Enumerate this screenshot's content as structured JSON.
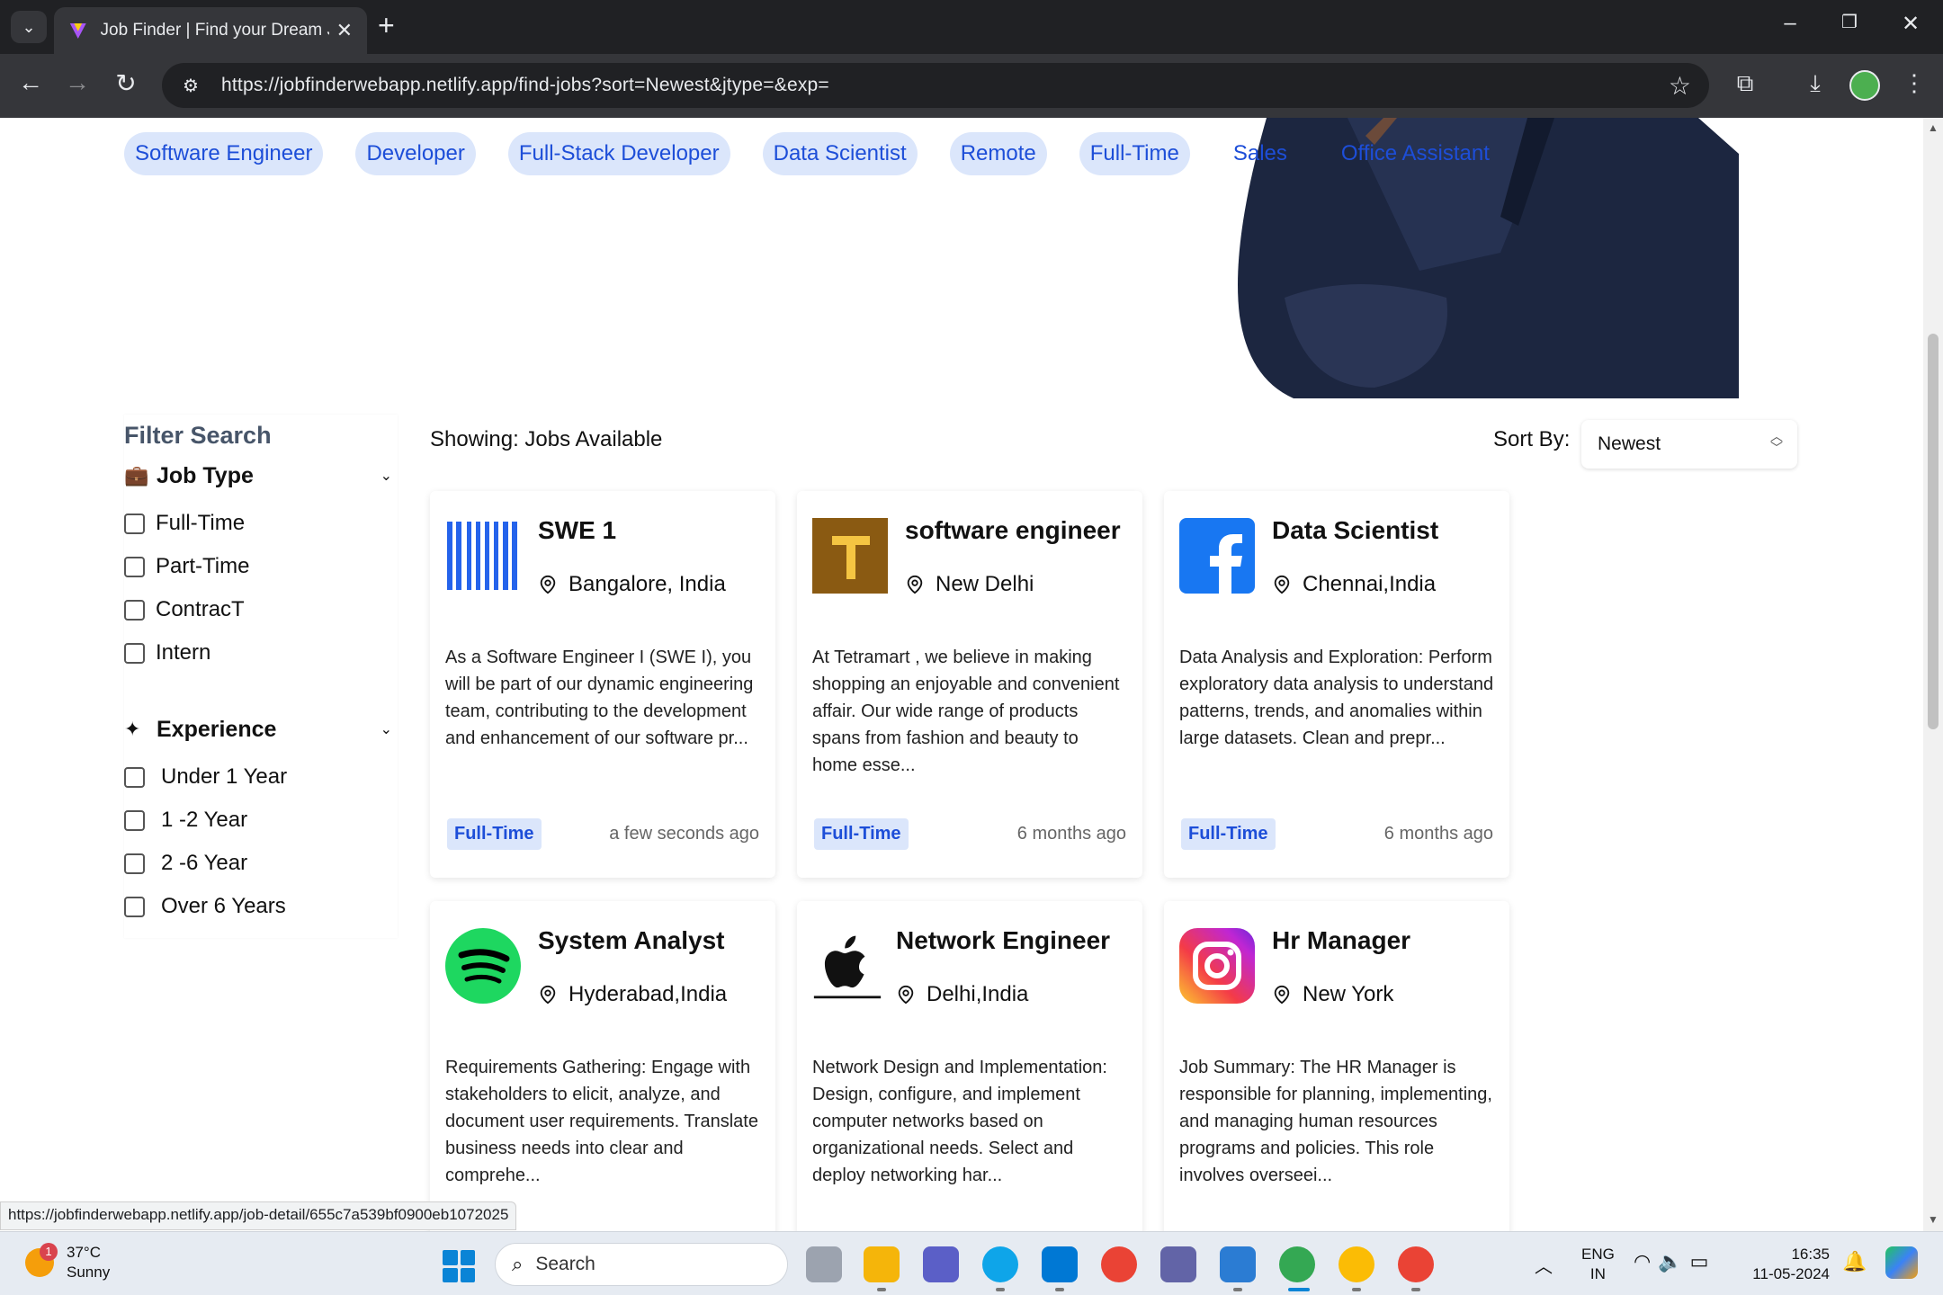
{
  "browser": {
    "tab_title": "Job Finder | Find your Dream Jo",
    "url": "https://jobfinderwebapp.netlify.app/find-jobs?sort=Newest&jtype=&exp=",
    "status_url": "https://jobfinderwebapp.netlify.app/job-detail/655c7a539bf0900eb1072025"
  },
  "chips": [
    "Software Engineer",
    "Developer",
    "Full-Stack Developer",
    "Data Scientist",
    "Remote",
    "Full-Time",
    "Sales",
    "Office Assistant"
  ],
  "filter": {
    "title": "Filter Search",
    "job_type": {
      "label": "Job Type",
      "options": [
        "Full-Time",
        "Part-Time",
        "ContracT",
        "Intern"
      ]
    },
    "experience": {
      "label": "Experience",
      "options": [
        "Under 1 Year",
        "1 -2 Year",
        "2 -6 Year",
        "Over 6 Years"
      ]
    }
  },
  "results": {
    "showing": "Showing: Jobs Available",
    "sort_label": "Sort By:",
    "sort_value": "Newest"
  },
  "jobs": [
    {
      "title": "SWE 1",
      "location": "Bangalore, India",
      "logo": "intuit-logo",
      "description": "As a Software Engineer I (SWE I), you will be part of our dynamic engineering team, contributing to the development and enhancement of our software pr...",
      "type": "Full-Time",
      "posted": "a few seconds ago"
    },
    {
      "title": "software engineer",
      "location": "New Delhi",
      "logo": "tetramart-logo",
      "description": "At Tetramart , we believe in making shopping an enjoyable and convenient affair. Our wide range of products spans from fashion and beauty to home esse...",
      "type": "Full-Time",
      "posted": "6 months ago"
    },
    {
      "title": "Data Scientist",
      "location": "Chennai,India",
      "logo": "facebook-logo",
      "description": "Data Analysis and Exploration: Perform exploratory data analysis to understand patterns, trends, and anomalies within large datasets. Clean and prepr...",
      "type": "Full-Time",
      "posted": "6 months ago"
    },
    {
      "title": "System Analyst",
      "location": "Hyderabad,India",
      "logo": "spotify-logo",
      "description": "Requirements Gathering: Engage with stakeholders to elicit, analyze, and document user requirements. Translate business needs into clear and comprehe...",
      "type": "",
      "posted": ""
    },
    {
      "title": "Network Engineer",
      "location": "Delhi,India",
      "logo": "apple-logo",
      "description": "Network Design and Implementation: Design, configure, and implement computer networks based on organizational needs. Select and deploy networking har...",
      "type": "",
      "posted": ""
    },
    {
      "title": "Hr Manager",
      "location": "New York",
      "logo": "instagram-logo",
      "description": "Job Summary: The HR Manager is responsible for planning, implementing, and managing human resources programs and policies. This role involves overseei...",
      "type": "",
      "posted": ""
    }
  ],
  "taskbar": {
    "weather_temp": "37°C",
    "weather_desc": "Sunny",
    "weather_badge": "1",
    "search_placeholder": "Search",
    "lang_top": "ENG",
    "lang_bottom": "IN",
    "time": "16:35",
    "date": "11-05-2024"
  },
  "colors": {
    "chip_bg": "#dbe6fb",
    "chip_text": "#1d4ed8",
    "chrome_dark": "#202124",
    "chrome_toolbar": "#35363a"
  }
}
